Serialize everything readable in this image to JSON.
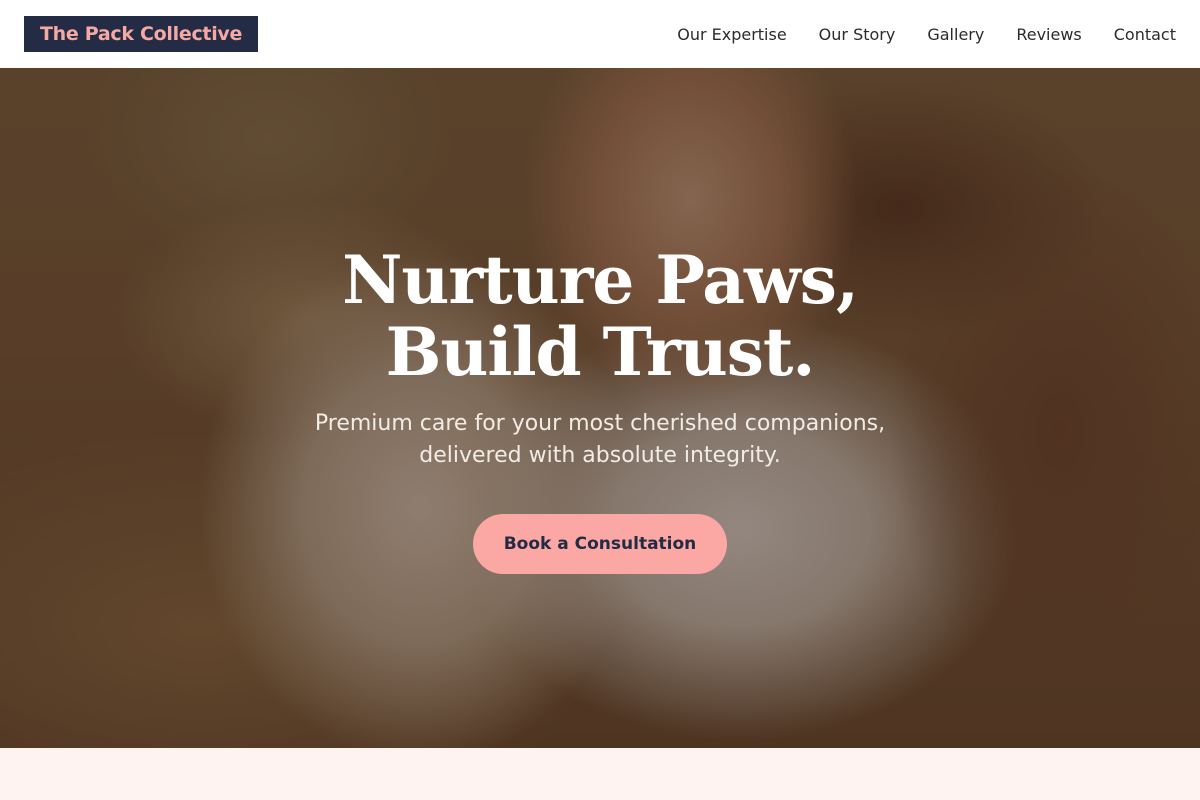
{
  "header": {
    "brand": "The Pack Collective",
    "nav": [
      {
        "label": "Our Expertise"
      },
      {
        "label": "Our Story"
      },
      {
        "label": "Gallery"
      },
      {
        "label": "Reviews"
      },
      {
        "label": "Contact"
      }
    ]
  },
  "hero": {
    "title_line1": "Nurture Paws,",
    "title_line2": "Build Trust.",
    "subtitle_line1": "Premium care for your most cherished companions,",
    "subtitle_line2": "delivered with absolute integrity.",
    "cta_label": "Book a Consultation"
  },
  "colors": {
    "brand_bg": "#232b45",
    "brand_text": "#f4a9a3",
    "cta_bg": "#fba7a3",
    "cta_text": "#232b45",
    "section_bg": "#fff3f1"
  }
}
